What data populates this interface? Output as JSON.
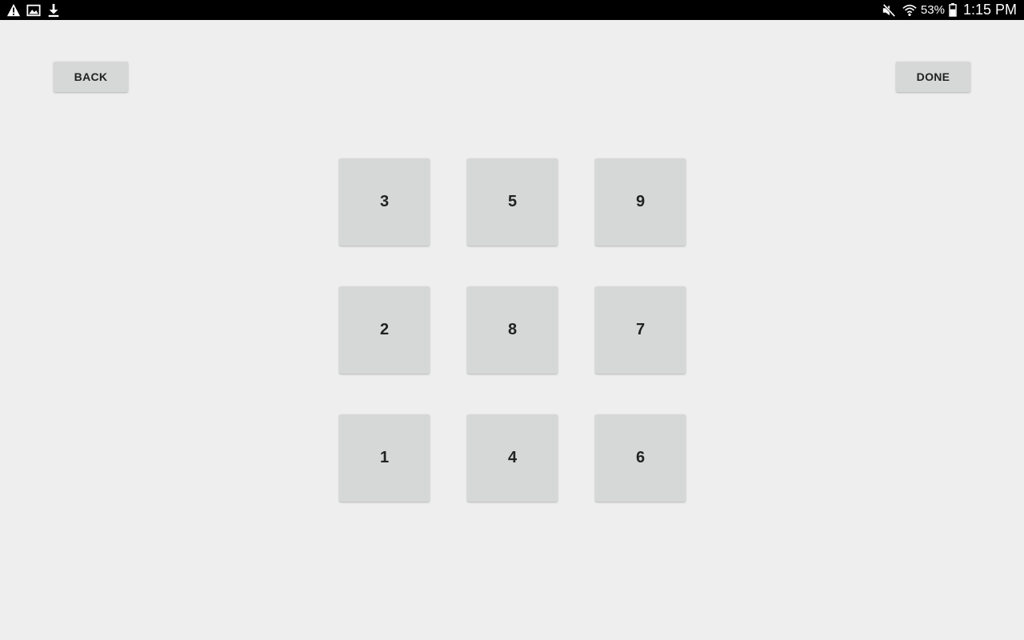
{
  "status_bar": {
    "left_icons": [
      "warning-icon",
      "image-icon",
      "download-icon"
    ],
    "right_icons": [
      "mute-icon",
      "wifi-icon",
      "battery-icon"
    ],
    "battery_percent": "53%",
    "time": "1:15 PM"
  },
  "buttons": {
    "back_label": "BACK",
    "done_label": "DONE"
  },
  "grid": {
    "tiles": [
      "3",
      "5",
      "9",
      "2",
      "8",
      "7",
      "1",
      "4",
      "6"
    ]
  },
  "colors": {
    "background": "#eeeeee",
    "button": "#d6d7d7",
    "text": "#222222",
    "status_bar": "#000000"
  }
}
